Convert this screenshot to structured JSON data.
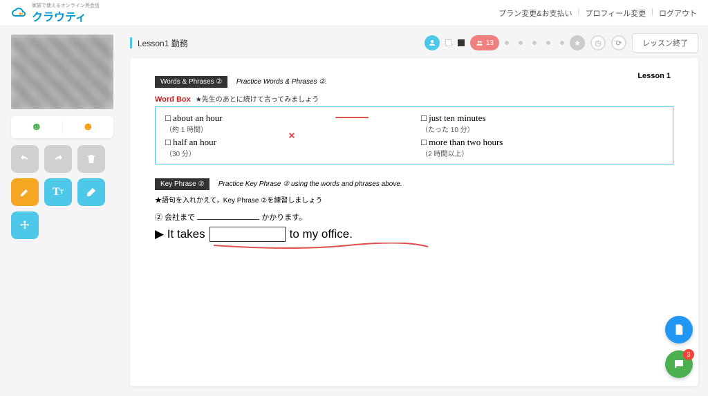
{
  "header": {
    "brand": "クラウティ",
    "brand_sub": "家族で使えるオンライン英会話",
    "nav": {
      "plan": "プラン変更&お支払い",
      "profile": "プロフィール変更",
      "logout": "ログアウト"
    }
  },
  "lesson": {
    "title": "Lesson1 勤務"
  },
  "toolbar": {
    "participant_count": "13",
    "end_button": "レッスン終了"
  },
  "slide": {
    "lesson_label": "Lesson 1",
    "words_section": {
      "label": "Words & Phrases ②",
      "sub": "Practice Words & Phrases ②."
    },
    "wordbox_title": "Word Box",
    "wordbox_instruction": "★先生のあとに続けて言ってみましょう",
    "items": [
      {
        "en": "□ about an hour",
        "jp": "（約 1 時間）"
      },
      {
        "en": "□ just ten minutes",
        "jp": "（たった 10 分）"
      },
      {
        "en": "□ half an hour",
        "jp": "（30 分）"
      },
      {
        "en": "□ more than two hours",
        "jp": "（2 時間以上）"
      }
    ],
    "keyphrase": {
      "label": "Key Phrase ②",
      "sub": "Practice Key Phrase ② using the words and phrases above.",
      "instruction": "★語句を入れかえて，Key Phrase ②を練習しましょう",
      "jp_prefix": "② 会社まで",
      "jp_suffix": "かかります。",
      "en_prefix": "▶ It takes",
      "en_suffix": "to my office."
    }
  },
  "fab": {
    "badge": "3"
  }
}
